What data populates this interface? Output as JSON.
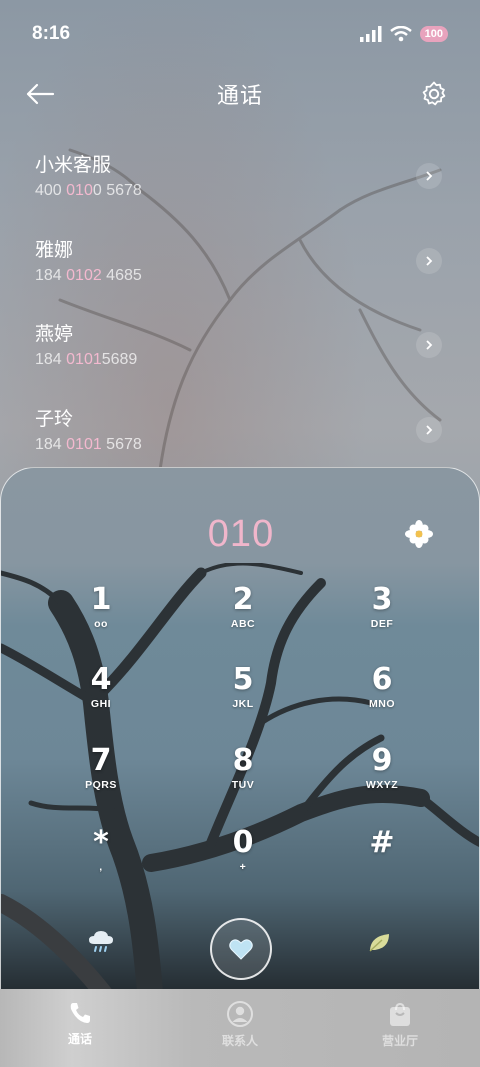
{
  "status_bar": {
    "time": "8:16",
    "battery": "100"
  },
  "header": {
    "title": "通话"
  },
  "contacts": [
    {
      "name": "小米客服",
      "number_parts": [
        "400 ",
        "010",
        "0 5678"
      ]
    },
    {
      "name": "雅娜",
      "number_parts": [
        "184 ",
        "0102",
        " 4685"
      ]
    },
    {
      "name": "燕婷",
      "number_parts": [
        "184 ",
        "0101",
        "5689"
      ]
    },
    {
      "name": "子玲",
      "number_parts": [
        "184 ",
        "0101",
        " 5678"
      ]
    }
  ],
  "dialer": {
    "digits": "010",
    "keys": [
      {
        "num": "1",
        "letters": "ᴏᴏ"
      },
      {
        "num": "2",
        "letters": "ABC"
      },
      {
        "num": "3",
        "letters": "DEF"
      },
      {
        "num": "4",
        "letters": "GHI"
      },
      {
        "num": "5",
        "letters": "JKL"
      },
      {
        "num": "6",
        "letters": "MNO"
      },
      {
        "num": "7",
        "letters": "PQRS"
      },
      {
        "num": "8",
        "letters": "TUV"
      },
      {
        "num": "9",
        "letters": "WXYZ"
      },
      {
        "num": "*",
        "letters": ","
      },
      {
        "num": "0",
        "letters": "+"
      },
      {
        "num": "#",
        "letters": ""
      }
    ]
  },
  "tabs": [
    {
      "label": "通话",
      "icon": "phone-icon",
      "active": true
    },
    {
      "label": "联系人",
      "icon": "person-icon",
      "active": false
    },
    {
      "label": "营业厅",
      "icon": "bag-icon",
      "active": false
    }
  ],
  "colors": {
    "accent_pink": "#f0b6cb",
    "battery_pink": "#e8a3bd"
  }
}
